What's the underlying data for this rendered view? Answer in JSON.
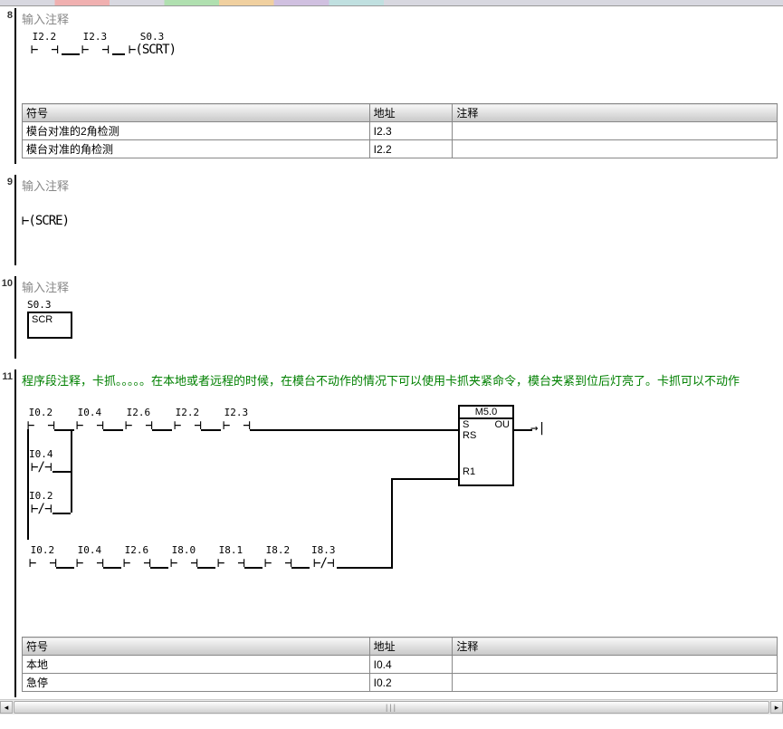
{
  "section8": {
    "num": "8",
    "title": "输入注释",
    "contacts": {
      "c1": "I2.2",
      "c2": "I2.3",
      "c3": "S0.3",
      "coil": "SCRT"
    },
    "table": {
      "h1": "符号",
      "h2": "地址",
      "h3": "注释",
      "rows": [
        {
          "sym": "模台对准的2角检测",
          "addr": "I2.3",
          "cmt": ""
        },
        {
          "sym": "模台对准的角检测",
          "addr": "I2.2",
          "cmt": ""
        }
      ]
    }
  },
  "section9": {
    "num": "9",
    "title": "输入注释",
    "coil": "SCRE"
  },
  "section10": {
    "num": "10",
    "title": "输入注释",
    "lbl": "S0.3",
    "box": "SCR"
  },
  "section11": {
    "num": "11",
    "title": "程序段注释，卡抓。。。。。在本地或者远程的时候，在模台不动作的情况下可以使用卡抓夹紧命令，模台夹紧到位后灯亮了。卡抓可以不动作",
    "rung1": {
      "c1": "I0.2",
      "c2": "I0.4",
      "c3": "I2.6",
      "c4": "I2.2",
      "c5": "I2.3"
    },
    "branch1a": "I0.4",
    "branch1b": "I0.2",
    "rung2": {
      "c1": "I0.2",
      "c2": "I0.4",
      "c3": "I2.6",
      "c4": "I8.0",
      "c5": "I8.1",
      "c6": "I8.2",
      "c7": "I8.3"
    },
    "block": {
      "title": "M5.0",
      "s": "S",
      "out": "OU",
      "rs": "RS",
      "r1": "R1"
    },
    "table": {
      "h1": "符号",
      "h2": "地址",
      "h3": "注释",
      "rows": [
        {
          "sym": "本地",
          "addr": "I0.4",
          "cmt": ""
        },
        {
          "sym": "急停",
          "addr": "I0.2",
          "cmt": ""
        }
      ]
    }
  }
}
